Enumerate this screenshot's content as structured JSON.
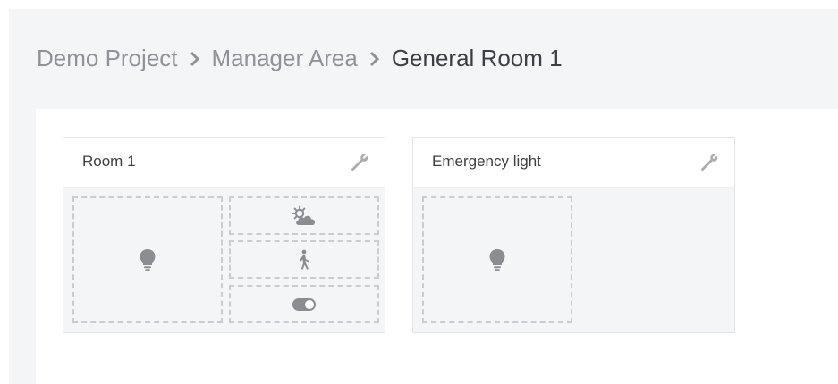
{
  "breadcrumb": {
    "items": [
      "Demo Project",
      "Manager Area"
    ],
    "current": "General Room 1"
  },
  "cards": [
    {
      "title": "Room 1",
      "settings_icon": "wrench-icon",
      "slots": [
        {
          "icon": "lightbulb-icon"
        },
        {
          "icon": "sun-cloud-icon"
        },
        {
          "icon": "motion-person-icon"
        },
        {
          "icon": "toggle-icon"
        }
      ]
    },
    {
      "title": "Emergency light",
      "settings_icon": "wrench-icon",
      "slots": [
        {
          "icon": "lightbulb-icon"
        }
      ]
    }
  ],
  "colors": {
    "icon": "#8a8d92",
    "dashed_border": "#c9ccd1",
    "page_bg": "#f4f5f7",
    "breadcrumb_text": "#8f9399",
    "breadcrumb_current": "#3b3e43"
  }
}
